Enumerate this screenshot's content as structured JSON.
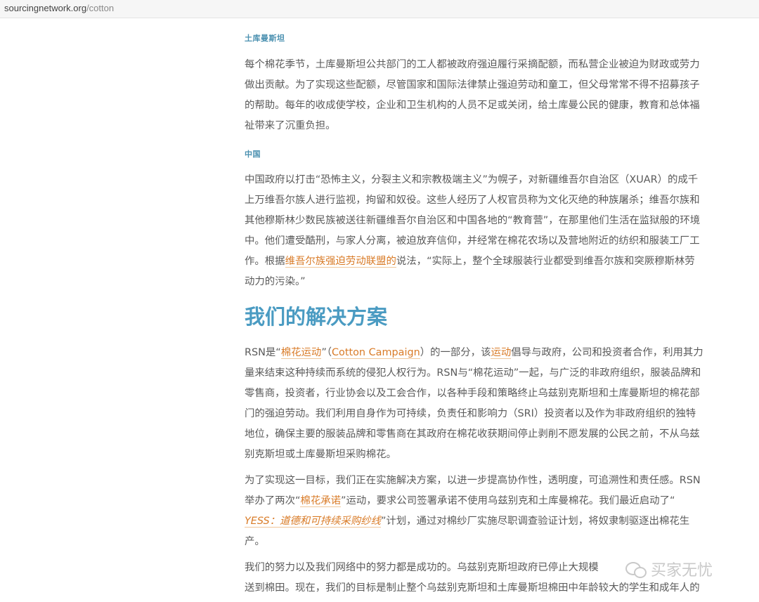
{
  "address_bar": {
    "domain": "sourcingnetwork.org",
    "path": "/cotton"
  },
  "turkmenistan": {
    "heading": "土库曼斯坦",
    "lines": [
      "每个棉花季节，土库曼斯坦公共部门的工人都被政府强迫履行采摘配额，而私营企业被迫为财政或劳力",
      "做出贡献。为了实现这些配额，尽管国家和国际法律禁止强迫劳动和童工，但父母常常不得不招募孩子",
      "的帮助。每年的收成使学校，企业和卫生机构的人员不足或关闭，给土库曼公民的健康，教育和总体福",
      "祉带来了沉重负担。"
    ]
  },
  "china": {
    "heading": "中国",
    "lines": [
      "中国政府以打击“恐怖主义，分裂主义和宗教极端主义”为幌子，对新疆维吾尔自治区（XUAR）的成千",
      "上万维吾尔族人进行监视，拘留和奴役。这些人经历了人权官员称为文化灭绝的种族屠杀；维吾尔族和",
      "其他穆斯林少数民族被送往新疆维吾尔自治区和中国各地的“教育营”，在那里他们生活在监狱般的环境",
      "中。他们遭受酷刑，与家人分离，被迫放弃信仰，并经常在棉花农场以及营地附近的纺织和服装工厂工"
    ],
    "line5_before": "作。根据",
    "line5_link": "维吾尔族强迫劳动联盟的",
    "line5_after": "说法，“实际上，整个全球服装行业都受到维吾尔族和突厥穆斯林劳",
    "line6": "动力的污染。”"
  },
  "solution": {
    "heading": "我们的解决方案",
    "p1": {
      "l1_a": "RSN是“",
      "l1_link1": "棉花运动",
      "l1_b": "”（",
      "l1_link2": "Cotton Campaign",
      "l1_c": "）的一部分，该",
      "l1_link3": "运动",
      "l1_d": "倡导与政府，公司和投资者合作，利用其力",
      "rest": [
        "量来结束这种持续而系统的侵犯人权行为。RSN与“棉花运动”一起，与广泛的非政府组织，服装品牌和",
        "零售商，投资者，行业协会以及工会合作，以各种手段和策略终止乌兹别克斯坦和土库曼斯坦的棉花部",
        "门的强迫劳动。我们利用自身作为可持续，负责任和影响力（SRI）投资者以及作为非政府组织的独特",
        "地位，确保主要的服装品牌和零售商在其政府在棉花收获期间停止剥削不愿发展的公民之前，不从乌兹",
        "别克斯坦或土库曼斯坦采购棉花。"
      ]
    },
    "p2": {
      "l1": "为了实现这一目标，我们正在实施解决方案，以进一步提高协作性，透明度，可追溯性和责任感。RSN",
      "l2_a": "举办了两次“",
      "l2_link": "棉花承诺",
      "l2_b": "”运动，要求公司签署承诺不使用乌兹别克和土库曼棉花。我们最近启动了“",
      "l3_link": "YESS：道德和可持续采购纱线",
      "l3_b": "”计划，通过对棉纱厂实施尽职调查验证计划，将奴隶制驱逐出棉花生",
      "l4": "产。"
    },
    "p3": {
      "l1": "我们的努力以及我们网络中的努力都是成功的。乌兹别克斯坦政府已停止大规模",
      "l2": "送到棉田。现在，我们的目标是制止整个乌兹别克斯坦和土库曼斯坦棉田中年龄较大的学生和成年人的"
    }
  },
  "watermark": {
    "text": "买家无忧",
    "icon": "wechat-icon"
  },
  "colors": {
    "text": "#5a5a5a",
    "heading": "#4a9bc2",
    "subheading": "#4a90b0",
    "link": "#d97b27"
  }
}
